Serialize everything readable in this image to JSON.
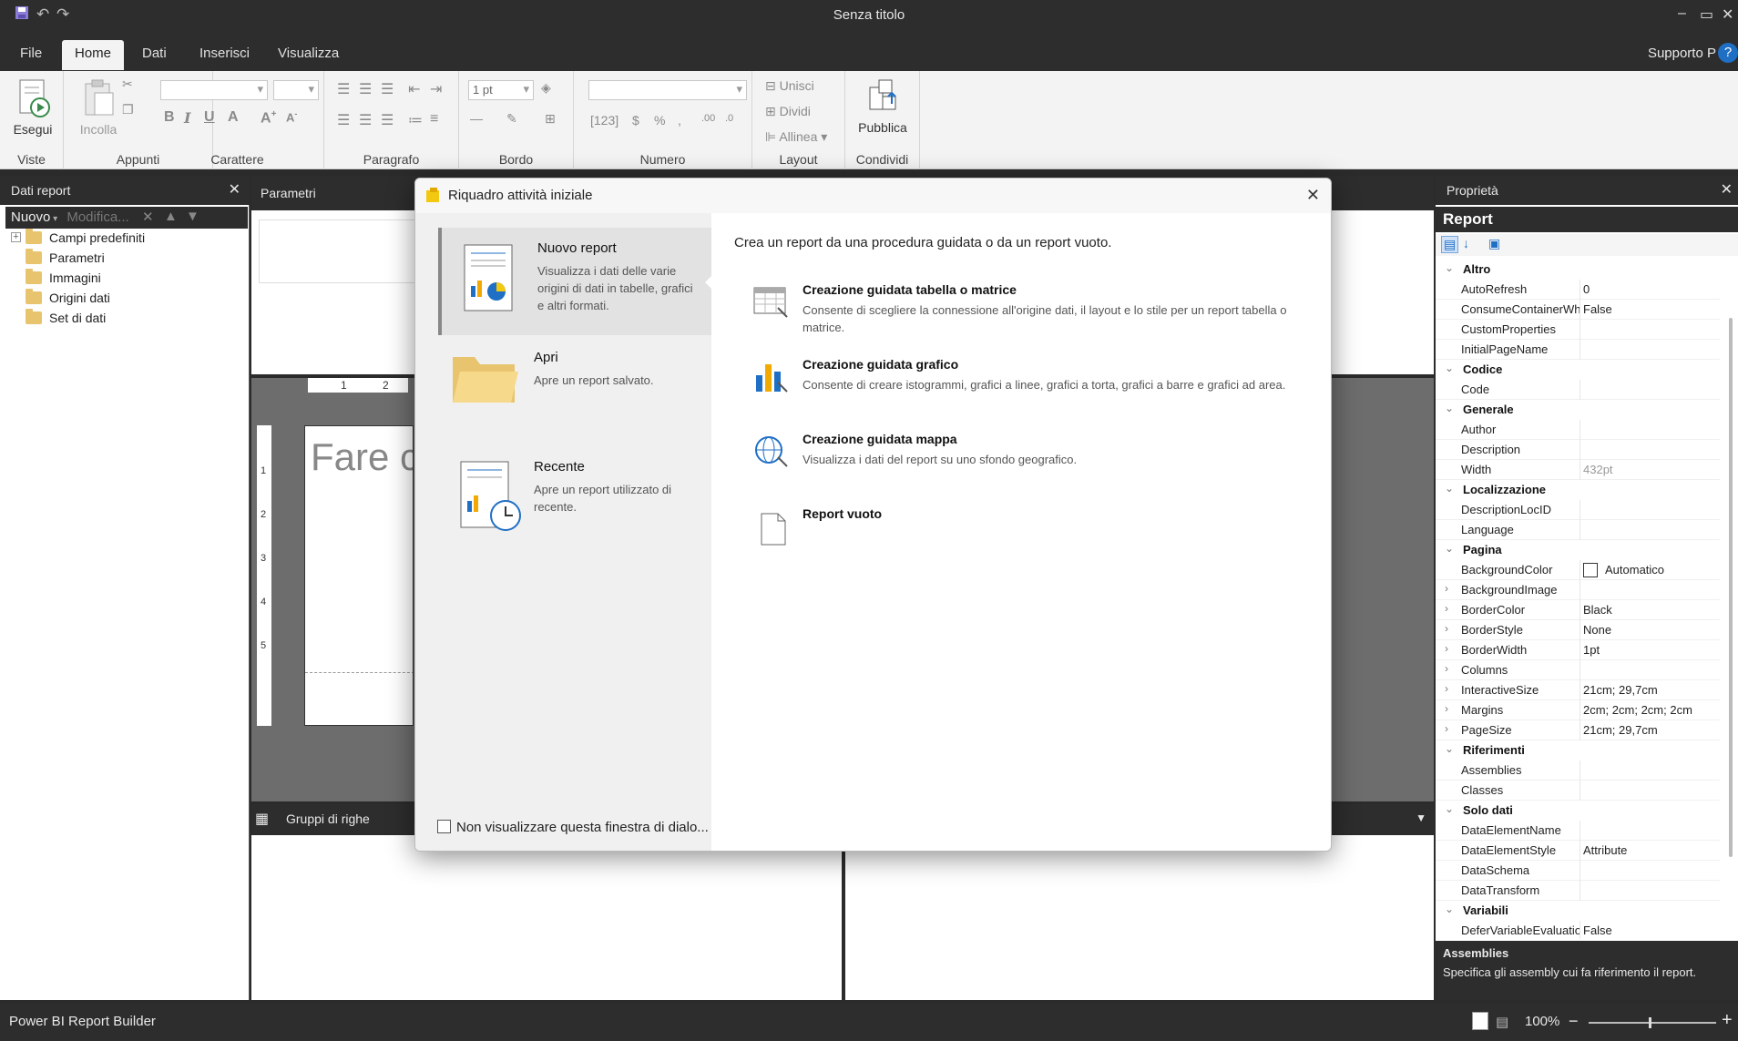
{
  "window": {
    "title": "Senza titolo"
  },
  "ribbon": {
    "tabs": [
      "File",
      "Home",
      "Dati",
      "Inserisci",
      "Visualizza"
    ],
    "support_label": "Supporto P",
    "help_label": "?",
    "groups": {
      "viste": {
        "label": "Viste",
        "run_label": "Esegui"
      },
      "appunti": {
        "label": "Appunti",
        "paste_label": "Incolla"
      },
      "carattere": {
        "label": "Carattere"
      },
      "paragrafo": {
        "label": "Paragrafo"
      },
      "bordo": {
        "label": "Bordo",
        "width_value": "1 pt"
      },
      "numero": {
        "label": "Numero"
      },
      "layout": {
        "label": "Layout",
        "merge_label": "Unisci",
        "split_label": "Dividi",
        "align_label": "Allinea"
      },
      "condividi": {
        "label": "Condividi",
        "publish_label": "Pubblica"
      }
    }
  },
  "report_data": {
    "title": "Dati report",
    "toolbar": {
      "new_label": "Nuovo",
      "edit_label": "Modifica..."
    },
    "tree": [
      "Campi predefiniti",
      "Parametri",
      "Immagini",
      "Origini dati",
      "Set di dati"
    ]
  },
  "center": {
    "parameters_title": "Parametri",
    "ruler_labels": [
      "1",
      "2"
    ],
    "vertical_ruler": [
      "1",
      "2",
      "3",
      "4",
      "5"
    ],
    "canvas_hint": "Fare c",
    "row_groups_title": "Gruppi di righe"
  },
  "dialog": {
    "title": "Riquadro attività iniziale",
    "nav": [
      {
        "title": "Nuovo report",
        "desc": "Visualizza i dati delle varie origini di dati in tabelle, grafici e altri formati."
      },
      {
        "title": "Apri",
        "desc": "Apre un report salvato."
      },
      {
        "title": "Recente",
        "desc": "Apre un report utilizzato di recente."
      }
    ],
    "dont_show_label": "Non visualizzare questa finestra di dialo...",
    "intro": "Crea un report da una procedura guidata o da un report vuoto.",
    "options": [
      {
        "title": "Creazione guidata tabella o matrice",
        "desc": "Consente di scegliere la connessione all'origine dati, il layout e lo stile per un report tabella o matrice."
      },
      {
        "title": "Creazione guidata grafico",
        "desc": "Consente di creare istogrammi, grafici a linee, grafici a torta, grafici a barre e grafici ad area."
      },
      {
        "title": "Creazione guidata mappa",
        "desc": "Visualizza i dati del report su uno sfondo geografico."
      },
      {
        "title": "Report vuoto",
        "desc": ""
      }
    ]
  },
  "properties": {
    "title": "Proprietà",
    "object": "Report",
    "rows": [
      {
        "type": "cat",
        "name": "Altro"
      },
      {
        "type": "prop",
        "name": "AutoRefresh",
        "value": "0"
      },
      {
        "type": "prop",
        "name": "ConsumeContainerWhitespace",
        "value": "False"
      },
      {
        "type": "prop",
        "name": "CustomProperties",
        "value": ""
      },
      {
        "type": "prop",
        "name": "InitialPageName",
        "value": ""
      },
      {
        "type": "cat",
        "name": "Codice"
      },
      {
        "type": "prop",
        "name": "Code",
        "value": ""
      },
      {
        "type": "cat",
        "name": "Generale"
      },
      {
        "type": "prop",
        "name": "Author",
        "value": ""
      },
      {
        "type": "prop",
        "name": "Description",
        "value": ""
      },
      {
        "type": "prop",
        "name": "Width",
        "value": "432pt",
        "disabled": true
      },
      {
        "type": "cat",
        "name": "Localizzazione"
      },
      {
        "type": "prop",
        "name": "DescriptionLocID",
        "value": ""
      },
      {
        "type": "prop",
        "name": "Language",
        "value": ""
      },
      {
        "type": "cat",
        "name": "Pagina"
      },
      {
        "type": "prop",
        "name": "BackgroundColor",
        "value": "Automatico",
        "swatch": true
      },
      {
        "type": "prop",
        "name": "BackgroundImage",
        "value": "",
        "expand": true
      },
      {
        "type": "prop",
        "name": "BorderColor",
        "value": "Black",
        "expand": true
      },
      {
        "type": "prop",
        "name": "BorderStyle",
        "value": "None",
        "expand": true
      },
      {
        "type": "prop",
        "name": "BorderWidth",
        "value": "1pt",
        "expand": true
      },
      {
        "type": "prop",
        "name": "Columns",
        "value": "",
        "expand": true
      },
      {
        "type": "prop",
        "name": "InteractiveSize",
        "value": "21cm; 29,7cm",
        "expand": true
      },
      {
        "type": "prop",
        "name": "Margins",
        "value": "2cm; 2cm; 2cm; 2cm",
        "expand": true
      },
      {
        "type": "prop",
        "name": "PageSize",
        "value": "21cm; 29,7cm",
        "expand": true
      },
      {
        "type": "cat",
        "name": "Riferimenti"
      },
      {
        "type": "prop",
        "name": "Assemblies",
        "value": ""
      },
      {
        "type": "prop",
        "name": "Classes",
        "value": ""
      },
      {
        "type": "cat",
        "name": "Solo dati"
      },
      {
        "type": "prop",
        "name": "DataElementName",
        "value": ""
      },
      {
        "type": "prop",
        "name": "DataElementStyle",
        "value": "Attribute"
      },
      {
        "type": "prop",
        "name": "DataSchema",
        "value": ""
      },
      {
        "type": "prop",
        "name": "DataTransform",
        "value": ""
      },
      {
        "type": "cat",
        "name": "Variabili"
      },
      {
        "type": "prop",
        "name": "DeferVariableEvaluation",
        "value": "False"
      }
    ],
    "desc_title": "Assemblies",
    "desc_text": "Specifica gli assembly cui fa riferimento il report."
  },
  "status": {
    "app_name": "Power BI Report Builder",
    "zoom": "100%"
  },
  "colors": {
    "accent": "#1f6fc5",
    "chrome": "#2d2d2d",
    "folder": "#e8c46f"
  }
}
